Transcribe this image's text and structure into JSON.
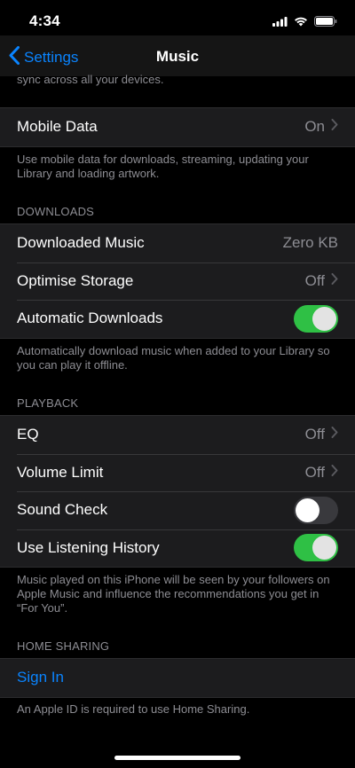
{
  "status": {
    "time": "4:34"
  },
  "nav": {
    "back_label": "Settings",
    "title": "Music"
  },
  "top_description": "sync across all your devices.",
  "mobile_data": {
    "label": "Mobile Data",
    "value": "On"
  },
  "mobile_data_footer": "Use mobile data for downloads, streaming, updating your Library and loading artwork.",
  "downloads": {
    "header": "DOWNLOADS",
    "items": [
      {
        "label": "Downloaded Music",
        "value": "Zero KB"
      },
      {
        "label": "Optimise Storage",
        "value": "Off"
      },
      {
        "label": "Automatic Downloads",
        "toggle": true
      }
    ],
    "footer": "Automatically download music when added to your Library so you can play it offline."
  },
  "playback": {
    "header": "PLAYBACK",
    "items": [
      {
        "label": "EQ",
        "value": "Off"
      },
      {
        "label": "Volume Limit",
        "value": "Off"
      },
      {
        "label": "Sound Check",
        "toggle": false
      },
      {
        "label": "Use Listening History",
        "toggle": true
      }
    ],
    "footer": "Music played on this iPhone will be seen by your followers on Apple Music and influence the recommendations you get in “For You”."
  },
  "home_sharing": {
    "header": "HOME SHARING",
    "sign_in_label": "Sign In",
    "footer": "An Apple ID is required to use Home Sharing."
  },
  "colors": {
    "accent": "#0a84ff",
    "toggle_on": "#32d74b",
    "toggle_off": "#39393d",
    "background": "#000000",
    "cell": "#1c1c1e"
  }
}
